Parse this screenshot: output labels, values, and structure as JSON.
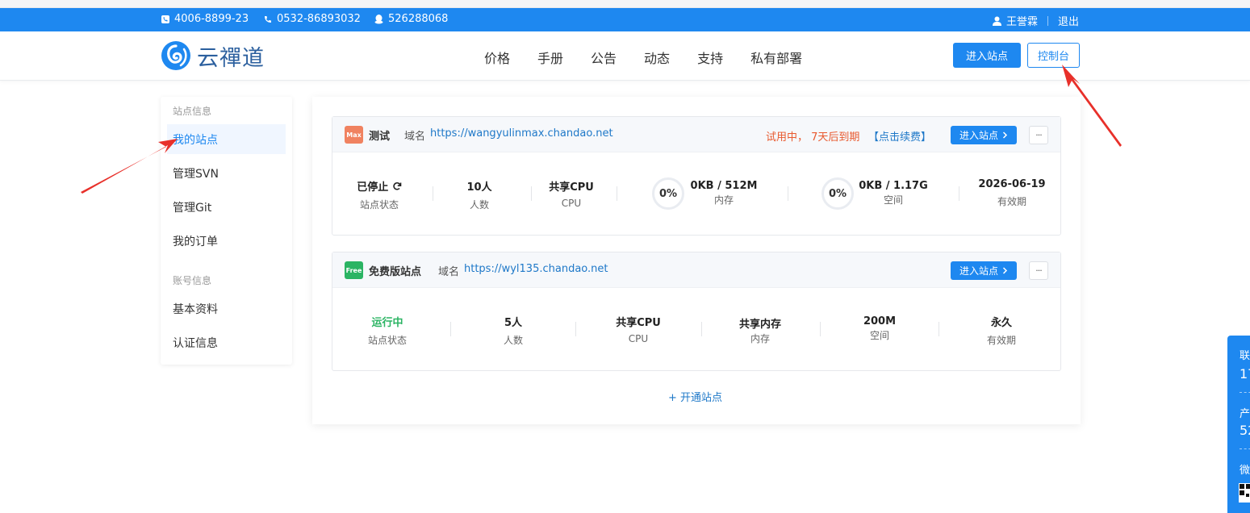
{
  "topbar": {
    "phone1": "4006-8899-23",
    "phone2": "0532-86893032",
    "qq": "526288068",
    "username": "王誉霖",
    "logout": "退出"
  },
  "header": {
    "logo_text": "云禪道",
    "nav": [
      "价格",
      "手册",
      "公告",
      "动态",
      "支持",
      "私有部署"
    ],
    "enter_site": "进入站点",
    "console": "控制台"
  },
  "sidebar": {
    "group1": "站点信息",
    "items1": [
      "我的站点",
      "管理SVN",
      "管理Git",
      "我的订单"
    ],
    "group2": "账号信息",
    "items2": [
      "基本资料",
      "认证信息"
    ]
  },
  "site1": {
    "badge": "Max",
    "name": "测试",
    "domain_label": "域名",
    "domain": "https://wangyulinmax.chandao.net",
    "trial": "试用中， 7天后到期",
    "renew": "【点击续费】",
    "enter": "进入站点",
    "more": "···",
    "stats": {
      "status": "已停止",
      "status_label": "站点状态",
      "users": "10人",
      "users_label": "人数",
      "cpu": "共享CPU",
      "cpu_label": "CPU",
      "mem_pct": "0%",
      "mem": "0KB / 512M",
      "mem_label": "内存",
      "disk_pct": "0%",
      "disk": "0KB / 1.17G",
      "disk_label": "空间",
      "expire": "2026-06-19",
      "expire_label": "有效期"
    }
  },
  "site2": {
    "badge": "Free",
    "name": "免费版站点",
    "domain_label": "域名",
    "domain": "https://wyl135.chandao.net",
    "enter": "进入站点",
    "more": "···",
    "stats": {
      "status": "运行中",
      "status_label": "站点状态",
      "users": "5人",
      "users_label": "人数",
      "cpu": "共享CPU",
      "cpu_label": "CPU",
      "mem": "共享内存",
      "mem_label": "内存",
      "disk": "200M",
      "disk_label": "空间",
      "expire": "永久",
      "expire_label": "有效期"
    }
  },
  "add_site": "+ 开通站点",
  "float_panel": {
    "label1": "联",
    "number1": "17",
    "label2": "产",
    "number2": "52",
    "label3": "微"
  },
  "colors": {
    "primary": "#1e88f0",
    "link": "#1e78c8",
    "warning": "#e8592e",
    "running": "#2bb463",
    "max_badge": "#f08260",
    "free_badge": "#2bb463",
    "arrow": "#e8302a"
  }
}
